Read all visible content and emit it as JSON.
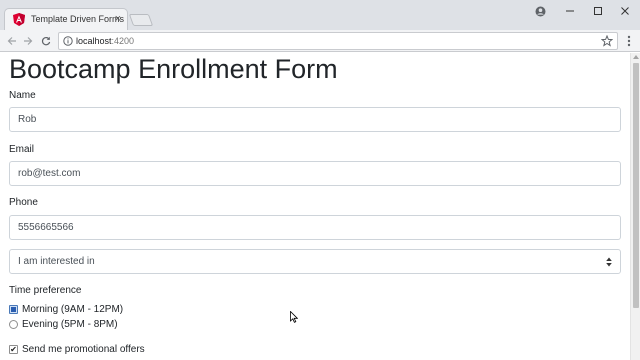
{
  "browser": {
    "tab_title": "Template Driven Forms",
    "tab_close": "×",
    "url_host": "localhost",
    "url_port": ":4200",
    "icons": [
      "angular-favicon-icon",
      "account-icon",
      "minimize-icon",
      "maximize-icon",
      "close-icon",
      "back-icon",
      "forward-icon",
      "reload-icon",
      "info-icon",
      "star-icon",
      "menu-icon"
    ]
  },
  "page": {
    "title": "Bootcamp Enrollment Form",
    "name_label": "Name",
    "name_value": "Rob",
    "email_label": "Email",
    "email_value": "rob@test.com",
    "phone_label": "Phone",
    "phone_value": "5556665566",
    "topic_selected": "I am interested in",
    "time_label": "Time preference",
    "time_options": [
      {
        "label": "Morning (9AM - 12PM)",
        "checked": true
      },
      {
        "label": "Evening (5PM - 8PM)",
        "checked": false
      }
    ],
    "promo_label": "Send me promotional offers",
    "promo_checked": true,
    "promo_mark": "✔"
  },
  "colors": {
    "angular_red": "#dd0031",
    "input_border": "#ced4da",
    "chrome_bg": "#dee1e6"
  }
}
